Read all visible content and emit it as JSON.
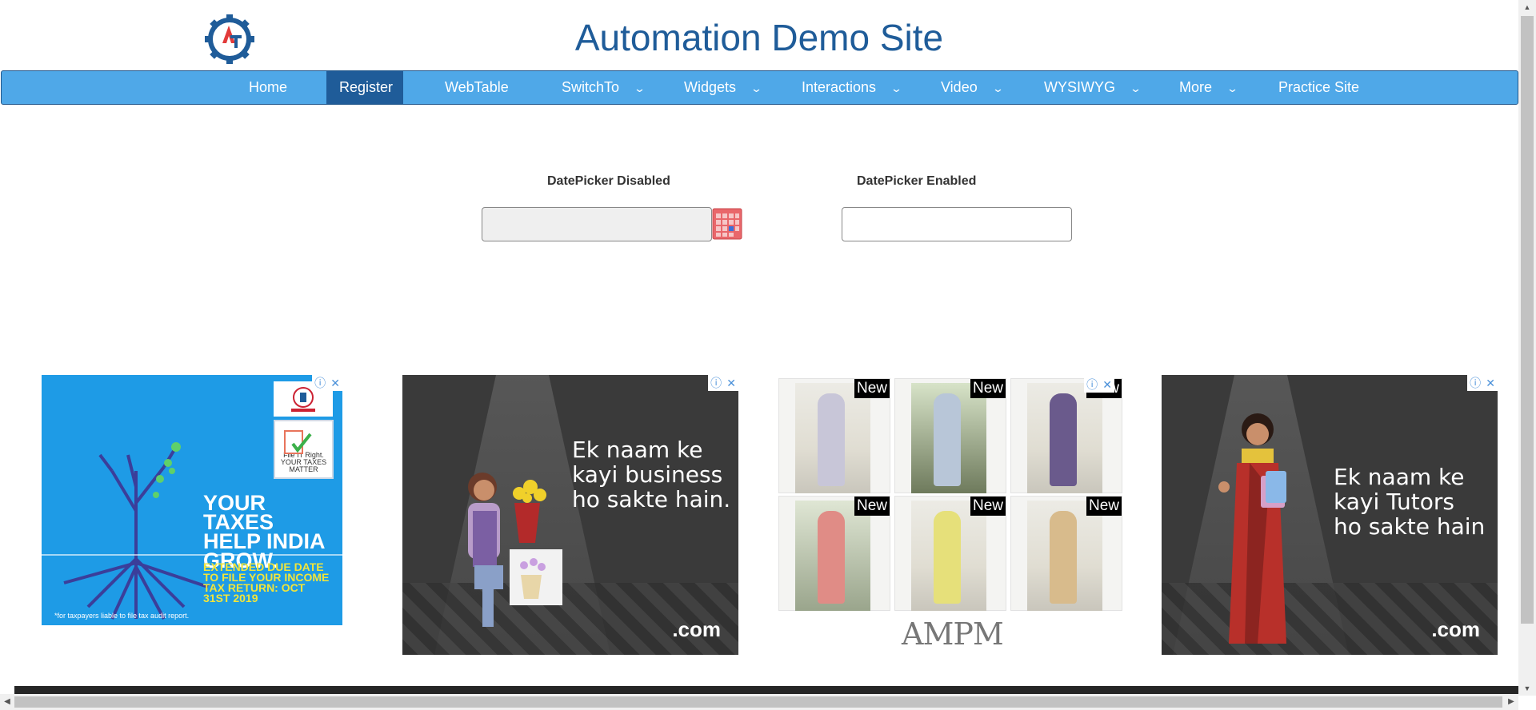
{
  "header": {
    "title": "Automation Demo Site",
    "logo_icon": "automation-testing-gear-logo"
  },
  "nav": {
    "items": [
      {
        "label": "Home",
        "active": false,
        "dropdown": false
      },
      {
        "label": "Register",
        "active": true,
        "dropdown": false
      },
      {
        "label": "WebTable",
        "active": false,
        "dropdown": false
      },
      {
        "label": "SwitchTo",
        "active": false,
        "dropdown": true
      },
      {
        "label": "Widgets",
        "active": false,
        "dropdown": true
      },
      {
        "label": "Interactions",
        "active": false,
        "dropdown": true
      },
      {
        "label": "Video",
        "active": false,
        "dropdown": true
      },
      {
        "label": "WYSIWYG",
        "active": false,
        "dropdown": true
      },
      {
        "label": "More",
        "active": false,
        "dropdown": true
      },
      {
        "label": "Practice Site",
        "active": false,
        "dropdown": false
      }
    ],
    "dropdown_icon": "chevron-down-icon"
  },
  "datepickers": {
    "disabled": {
      "label": "DatePicker Disabled",
      "value": "",
      "icon": "calendar-icon"
    },
    "enabled": {
      "label": "DatePicker Enabled",
      "value": ""
    }
  },
  "ads": {
    "tax": {
      "headline": "YOUR TAXES HELP INDIA GROW.",
      "subline": "EXTENDED DUE DATE TO FILE YOUR INCOME TAX RETURN: OCT 31ST 2019",
      "footnote": "*for taxpayers liable to file tax audit report.",
      "badge": "File IT Right. YOUR TAXES MATTER"
    },
    "business": {
      "text": "Ek naam ke kayi business ho sakte hain.",
      "domain": ".com"
    },
    "fashion": {
      "tag": "New",
      "brand": "AMPM"
    },
    "tutors": {
      "text": "Ek naam ke kayi Tutors ho sakte hain",
      "domain": ".com"
    }
  },
  "colors": {
    "nav_bg": "#4fa8e8",
    "nav_active": "#1f5c99",
    "title": "#1f5c99"
  }
}
